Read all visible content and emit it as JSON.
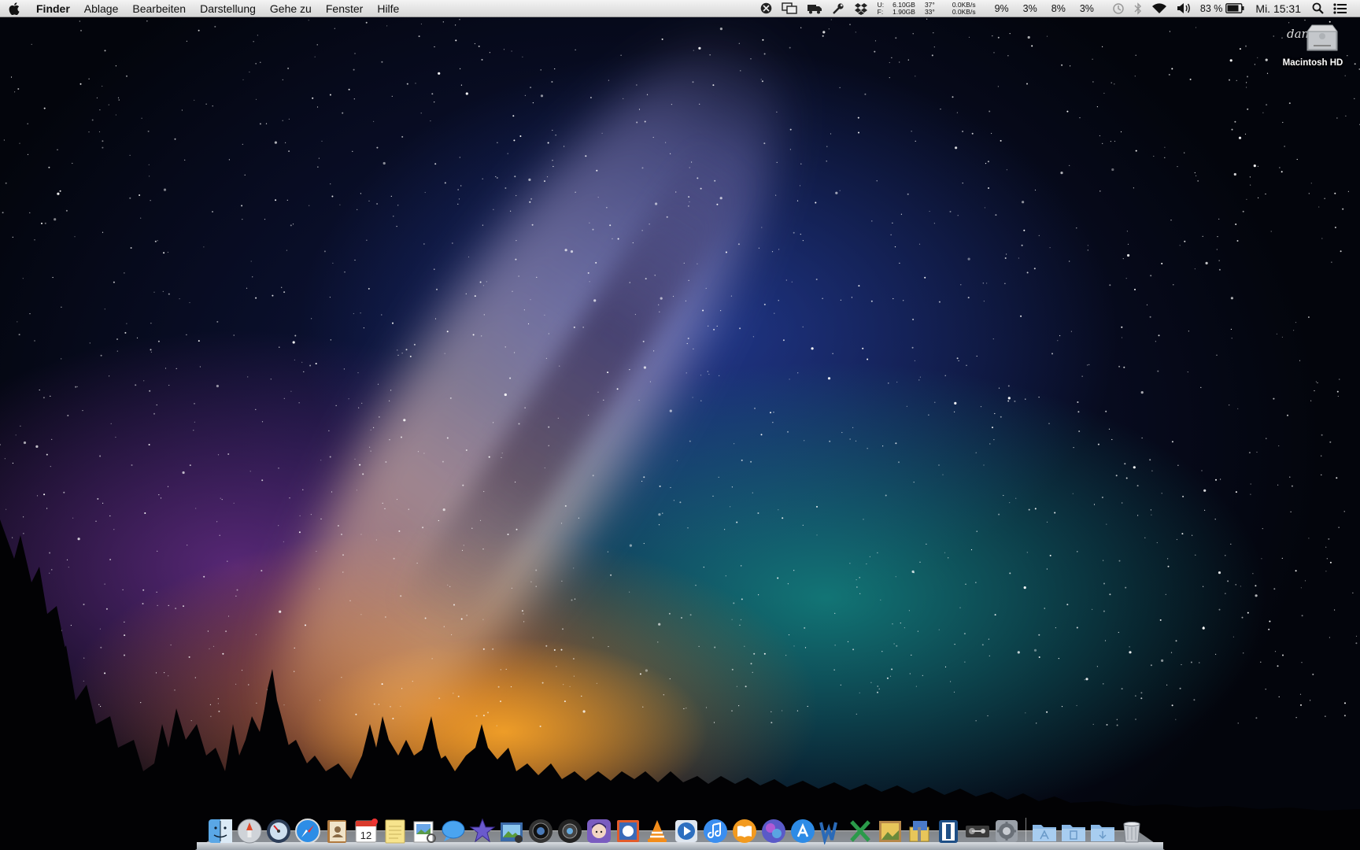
{
  "menubar": {
    "app_name": "Finder",
    "menus": [
      "Ablage",
      "Bearbeiten",
      "Darstellung",
      "Gehe zu",
      "Fenster",
      "Hilfe"
    ],
    "status": {
      "disk_u": "U:",
      "disk_f": "F:",
      "disk_used": "6.10GB",
      "disk_free": "1.90GB",
      "temp_1": "37°",
      "temp_2": "33°",
      "net_up": "0.0KB/s",
      "net_down": "0.0KB/s",
      "cpu_1": "9%",
      "cpu_2": "3%",
      "cpu_3": "8%",
      "cpu_4": "3%",
      "battery": "83 %",
      "clock": "Mi. 15:31"
    }
  },
  "desktop": {
    "drive_label": "Macintosh HD"
  },
  "dock": {
    "apps": [
      "finder-icon",
      "launchpad-icon",
      "dashboard-icon",
      "safari-icon",
      "contacts-icon",
      "calendar-icon",
      "notes-icon",
      "preview-icon",
      "messages-icon",
      "imovie-icon",
      "iphoto-icon",
      "aperture-icon",
      "photo-booth-icon",
      "character-app-icon",
      "mail-stamp-icon",
      "vlc-icon",
      "quicktime-icon",
      "itunes-icon",
      "ibooks-icon",
      "game-center-icon",
      "app-store-icon",
      "word-icon",
      "excel-icon",
      "photo-frame-icon",
      "archive-utility-icon",
      "text-editor-icon",
      "steam-icon",
      "system-preferences-icon"
    ],
    "calendar_day": "12",
    "folders": [
      "applications-folder-icon",
      "documents-folder-icon",
      "downloads-folder-icon"
    ],
    "trash": "trash-icon"
  }
}
